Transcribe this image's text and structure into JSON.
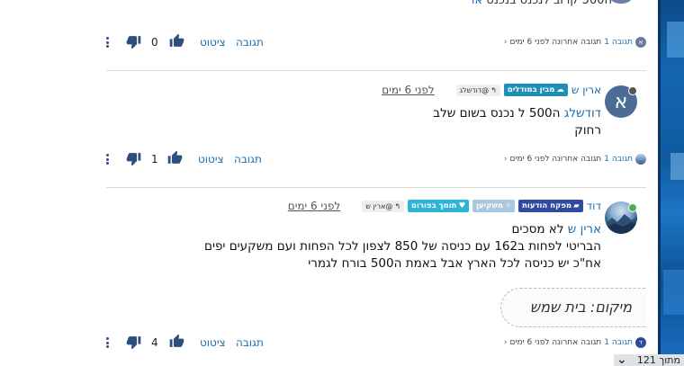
{
  "top_cut": {
    "text": "ה500 קרוב לנכנס בנכנס",
    "user_partial": "אר"
  },
  "posts": [
    {
      "actions": {
        "reply": "תגובה",
        "quote": "ציטוט",
        "votes": "0"
      },
      "meta": {
        "replies": "תגובה 1",
        "last": "תגובה אחרונה לפני 6 ימים",
        "avatar_letter": "א",
        "avatar_color": "#6b7a99"
      }
    },
    {
      "username": "ארין ש",
      "avatar_letter": "א",
      "badge": {
        "label": "מבין במודלים",
        "color": "#1e8fb5"
      },
      "reply_to": "@דודשלג",
      "time": "לפני 6 ימים",
      "body": {
        "mention": "דודשלג",
        "line1_rest": " ה500 ל נכנס בשום שלב",
        "line2": "רחוק"
      },
      "actions": {
        "reply": "תגובה",
        "quote": "ציטוט",
        "votes": "1"
      },
      "meta": {
        "replies": "תגובה 1",
        "last": "תגובה אחרונה לפני 6 ימים",
        "avatar_color": "#3f6d9a"
      }
    },
    {
      "username": "דוד",
      "badges": [
        {
          "label": "מפקח הודעות",
          "color": "#2f4aa0"
        },
        {
          "label": "משקיען",
          "color": "#a9c7df"
        },
        {
          "label": "תומך בפורום",
          "color": "#2db4d6"
        }
      ],
      "reply_to": "@ארין ש",
      "time": "לפני 6 ימים",
      "body": {
        "mention": "ארין ש",
        "line1_rest": " לא מסכים",
        "line2": "הבריטי לפחות ב162 עם כניסה של 850 לצפון לכל הפחות ועם משקעים יפים",
        "line3": "אח\"כ יש כניסה לכל הארץ אבל באמת ה500 בורח לגמרי"
      },
      "location": "מיקום: בית שמש",
      "actions": {
        "reply": "תגובה",
        "quote": "ציטוט",
        "votes": "4"
      },
      "meta": {
        "replies": "תגובה 1",
        "last": "תגובה אחרונה לפני 6 ימים",
        "avatar_letter": "ד",
        "avatar_color": "#2f4aa0"
      }
    }
  ],
  "bottom_strip": {
    "text": "מתוך 121"
  },
  "colors": {
    "link": "#1a6fb0",
    "online": "#4caf50",
    "offline": "#555555"
  }
}
